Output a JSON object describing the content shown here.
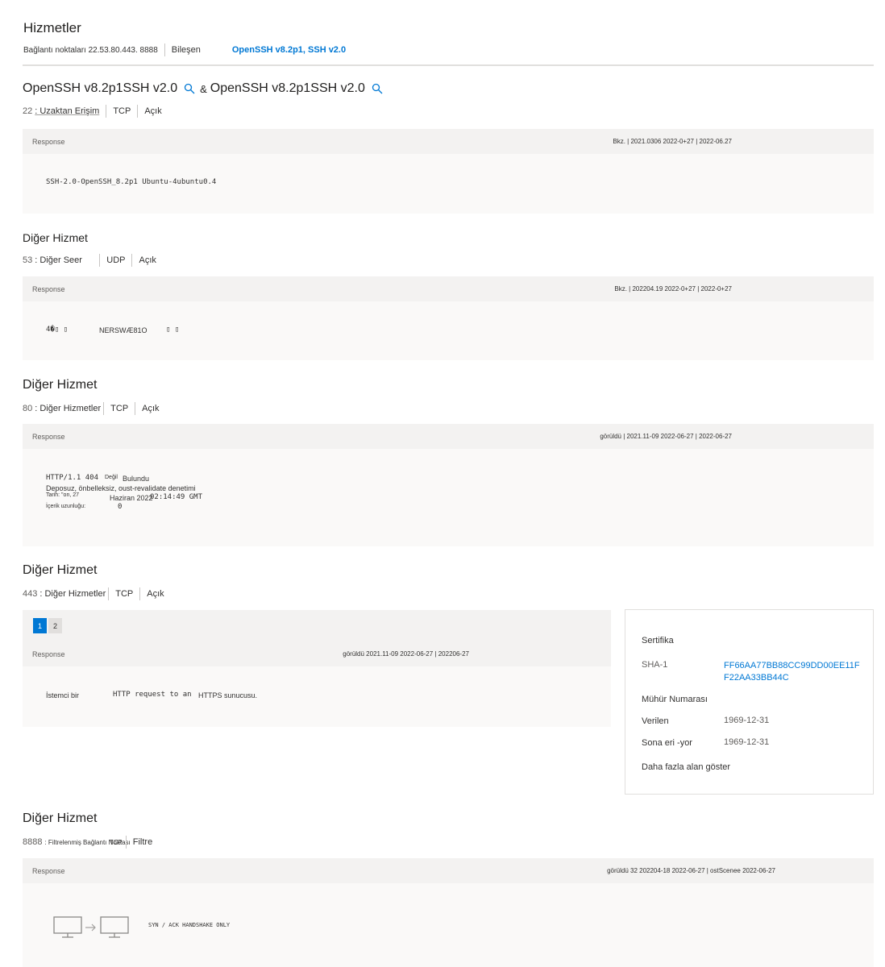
{
  "header": {
    "title": "Hizmetler",
    "endpoints_label": "Bağlantı noktaları 22.53.80.443. 8888",
    "component_label": "Bileşen",
    "component_value": "OpenSSH v8.2p1, SSH v2.0"
  },
  "services": [
    {
      "title_a": "OpenSSH v8.2p1SSH v2.0",
      "amp": "&",
      "title_b": "OpenSSH v8.2p1SSH v2.0",
      "port": "22",
      "name": ": Uzaktan Erişim",
      "protocol": "TCP",
      "state": "Açık",
      "response_label": "Response",
      "dates": "Bkz. | 2021.0306 2022-0+27 | 2022-06.27",
      "response_lines": [
        "SSH-2.0-OpenSSH_8.2p1 Ubuntu-4ubuntu0.4"
      ]
    },
    {
      "title": "Diğer Hizmet",
      "port": "53",
      "name": ": Diğer Seer",
      "protocol": "UDP",
      "state": "Açık",
      "response_label": "Response",
      "dates": "Bkz. | 202204.19 2022-0+27 | 2022-0+27",
      "response_a": "4�▯ ▯",
      "response_b": "NERSWÆ81O",
      "response_c": "▯ ▯"
    },
    {
      "title": "Diğer Hizmet",
      "port": "80",
      "name": ": Diğer Hizmetler",
      "protocol": "TCP",
      "state": "Açık",
      "response_label": "Response",
      "dates": "görüldü | 2021.11-09 2022-06-27 | 2022-06-27",
      "http_status": "HTTP/1.1 404",
      "http_status_word_1": "Değil",
      "http_status_word_2": "Bulundu",
      "line2": "Deposuz, önbelleksiz, oust-revalidate denetimi",
      "date_label": "Tarih: \"on, 27",
      "date_month": "Haziran 2022",
      "date_time": "02:14:49 GMT",
      "length_label": "İçerik uzunluğu:",
      "length_value": "0"
    },
    {
      "title": "Diğer Hizmet",
      "port": "443",
      "name": ": Diğer Hizmetler",
      "protocol": "TCP",
      "state": "Açık",
      "pages": [
        "1",
        "2"
      ],
      "response_label": "Response",
      "dates": "görüldü 2021.11-09 2022-06-27 | 202206-27",
      "resp_a": "İstemci bir",
      "resp_b": "HTTP request to an",
      "resp_c": "HTTPS sunucusu."
    },
    {
      "title": "Diğer Hizmet",
      "port": "8888",
      "name": ": Filtrelenmiş Bağlantı Noktası",
      "protocol": "TCP",
      "state": "Filtre",
      "response_label": "Response",
      "dates": "görüldü 32 202204-18 2022-06-27 | ostScenee 2022-06-27",
      "handshake": "SYN / ACK HANDSHAKE ONLY"
    }
  ],
  "certificate": {
    "title": "Sertifika",
    "sha_label": "SHA-1",
    "sha_line1": "FF66AA77BB88CC99DD00EE11F",
    "sha_line2": "F22AA33BB44C",
    "serial_label": "Mühür Numarası",
    "issued_label": "Verilen",
    "issued_value": "1969-12-31",
    "expires_label": "Sona eri -yor",
    "expires_value": "1969-12-31",
    "more_fields": "Daha fazla alan göster"
  },
  "colors": {
    "accent": "#0078d4",
    "panel_header": "#f3f2f1",
    "panel_body": "#faf9f8"
  },
  "icons": [
    "search-icon",
    "monitor-icon",
    "arrow-right-icon"
  ]
}
